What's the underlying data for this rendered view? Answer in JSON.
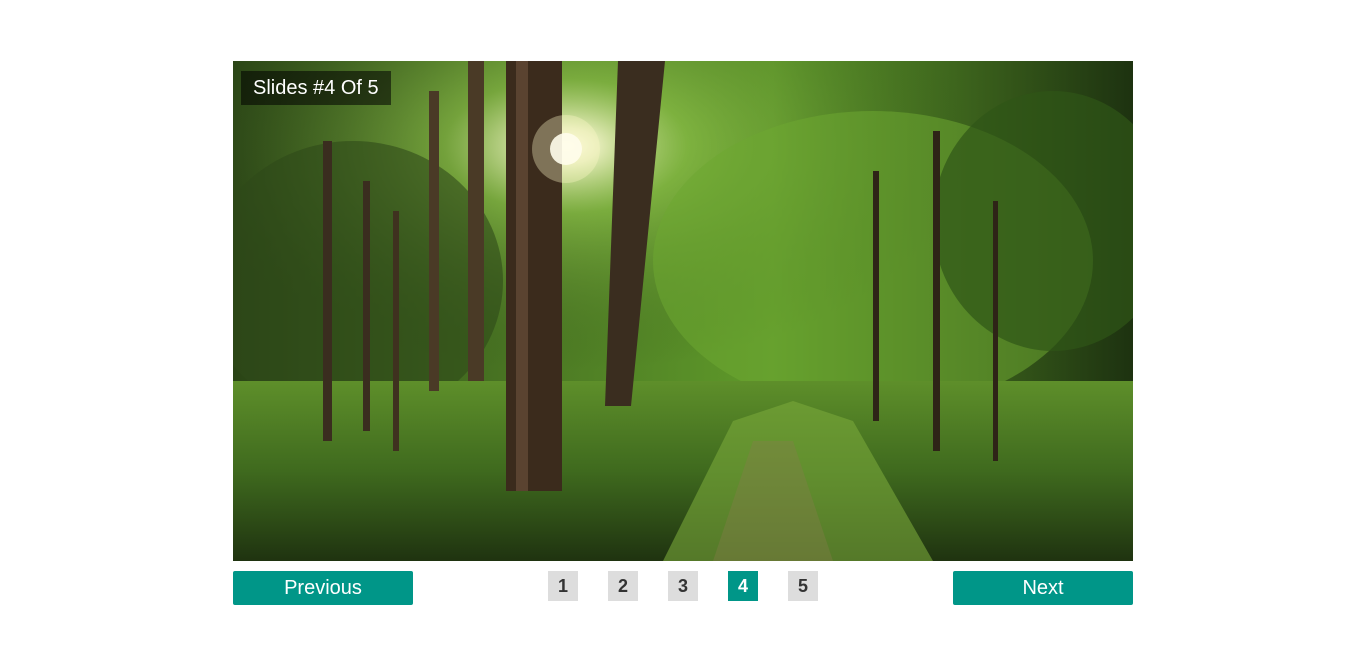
{
  "slider": {
    "counter": "Slides #4 Of 5",
    "current_slide": 4,
    "total_slides": 5,
    "image_subject": "forest-path"
  },
  "controls": {
    "previous_label": "Previous",
    "next_label": "Next",
    "dots": [
      "1",
      "2",
      "3",
      "4",
      "5"
    ],
    "active_dot": "4"
  },
  "colors": {
    "accent": "#009688",
    "dot_inactive": "#dddddd",
    "dot_text": "#333333",
    "counter_bg": "rgba(0,0,0,0.55)"
  }
}
